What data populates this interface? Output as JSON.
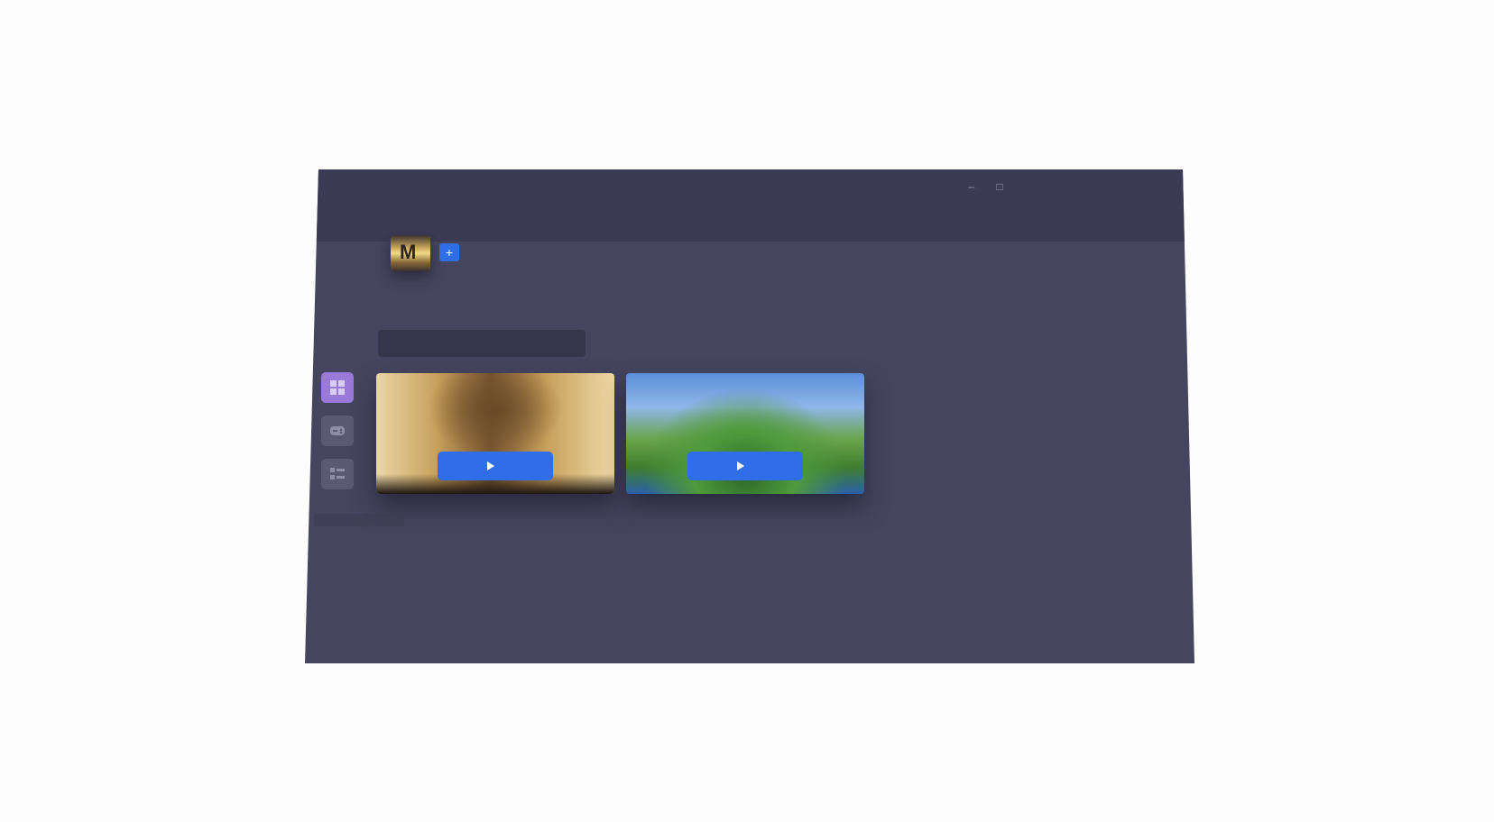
{
  "window": {
    "title": "",
    "minimize_glyph": "–",
    "maximize_glyph": "□"
  },
  "favorites": {
    "title": "",
    "tile_mark": "M",
    "add_glyph": "+"
  },
  "all_games": {
    "title": "",
    "filter_value": ""
  },
  "sidebar": {
    "items": [
      {
        "icon": "grid-icon",
        "active": true
      },
      {
        "icon": "controller-icon",
        "active": false
      },
      {
        "icon": "list-icon",
        "active": false
      }
    ]
  },
  "games": [
    {
      "play_label": "",
      "image": "civilization-art"
    },
    {
      "play_label": "",
      "image": "minecraft-art"
    }
  ],
  "colors": {
    "accent": "#2f6ee8",
    "active_nav": "#9a7ad8",
    "background": "#45455f",
    "titlebar": "#3b3b55"
  }
}
